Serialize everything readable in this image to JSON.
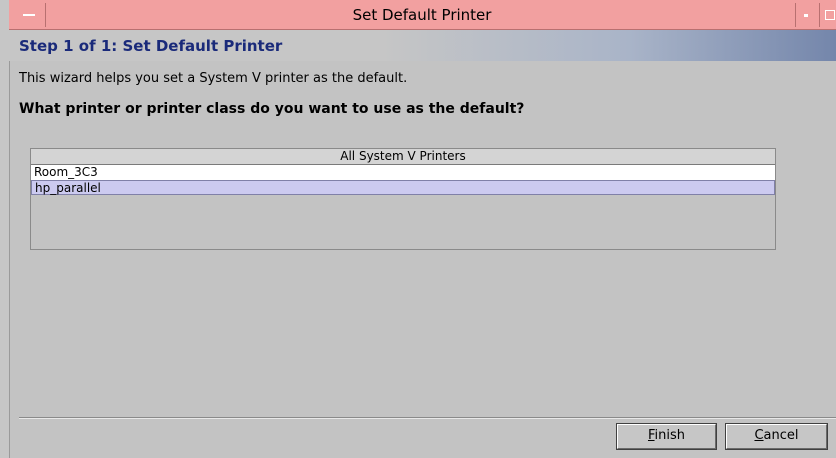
{
  "window": {
    "title": "Set Default Printer"
  },
  "header": {
    "step_title": "Step 1 of 1: Set Default Printer"
  },
  "main": {
    "intro_text": "This wizard helps you set a System V printer as the default.",
    "question": "What printer or printer class do you want to use as the default?"
  },
  "printer_table": {
    "column_header": "All System V Printers",
    "rows": [
      "Room_3C3",
      "hp_parallel"
    ],
    "selected_row": "hp_parallel"
  },
  "buttons": {
    "finish_mnemonic": "F",
    "finish_rest": "inish",
    "cancel_mnemonic": "C",
    "cancel_rest": "ancel"
  },
  "colors": {
    "titlebar": "#f2a0a0",
    "step_title": "#1a2a7a",
    "selection": "#cccaf0",
    "background": "#c3c3c3"
  },
  "icons": {
    "window_menu": "window-menu-icon",
    "minimize": "minimize-icon",
    "maximize": "maximize-icon"
  }
}
